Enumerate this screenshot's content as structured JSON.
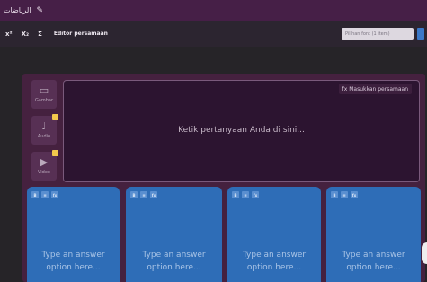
{
  "titlebar": {
    "title": "الرياضات",
    "pencil_icon": "pencil-icon"
  },
  "toolbar": {
    "superscript": "x²",
    "subscript": "X₂",
    "sum": "Σ",
    "equation_editor": "Editor persamaan",
    "font_select": "Pilihan font (1 item)"
  },
  "media": [
    {
      "label": "Gambar",
      "icon": "image-icon",
      "glyph": "▭"
    },
    {
      "label": "Audio",
      "icon": "microphone-icon",
      "glyph": "♩"
    },
    {
      "label": "Video",
      "icon": "video-icon",
      "glyph": "▶"
    }
  ],
  "question": {
    "equation_button": "fx Masukkan persamaan",
    "placeholder": "Ketik pertanyaan Anda di sini..."
  },
  "answers": [
    {
      "b": "B",
      "i": "≡",
      "fx": "fx",
      "text1": "Type an answer",
      "text2": "option here..."
    },
    {
      "b": "B",
      "i": "≡",
      "fx": "fx",
      "text1": "Type an answer",
      "text2": "option here..."
    },
    {
      "b": "B",
      "i": "≡",
      "fx": "fx",
      "text1": "Type an answer",
      "text2": "option here..."
    },
    {
      "b": "B",
      "i": "≡",
      "fx": "fx",
      "text1": "Type an answer",
      "text2": "option here..."
    }
  ],
  "colors": {
    "titlebar": "#461f47",
    "editor_bg": "#45213f",
    "question_bg": "#2c1430",
    "answer_card": "#2e6db7",
    "badge": "#f2c94c"
  }
}
